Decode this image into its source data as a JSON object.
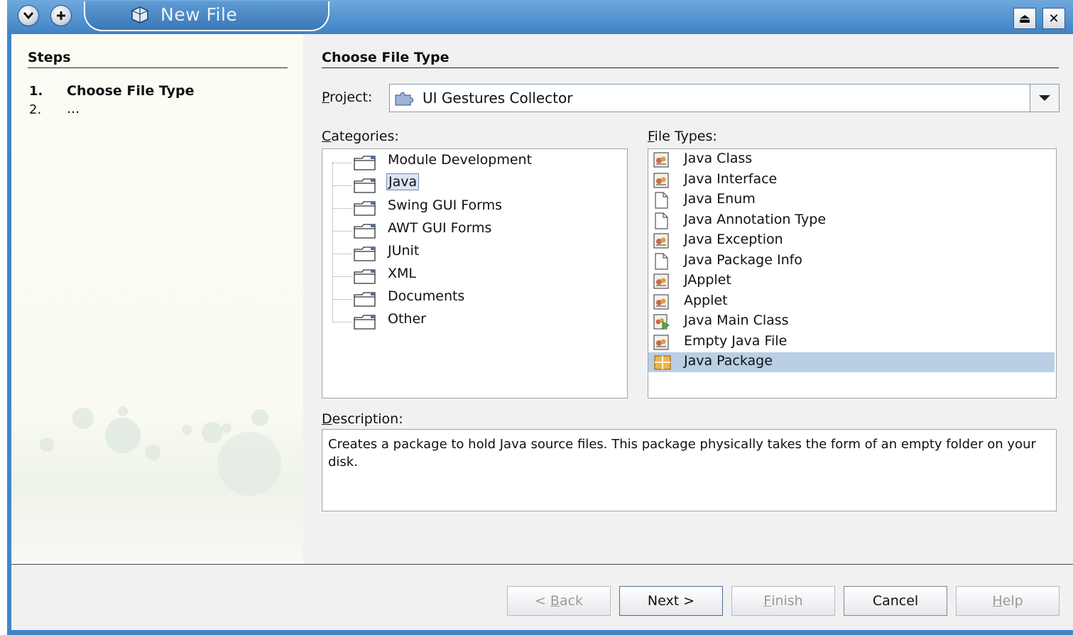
{
  "window": {
    "title": "New File",
    "menu_button": "menu",
    "add_button": "add",
    "maximize_glyph": "⏏",
    "close_glyph": "✕"
  },
  "steps": {
    "heading": "Steps",
    "items": [
      {
        "number": "1.",
        "label": "Choose File Type"
      },
      {
        "number": "2.",
        "label": "..."
      }
    ]
  },
  "main": {
    "heading": "Choose File Type",
    "project_label": "Project:",
    "project_value": "UI Gestures Collector",
    "categories_label": "Categories:",
    "file_types_label": "File Types:",
    "description_label": "Description:",
    "description_text": "Creates a package to hold Java source files. This package physically takes the form of an empty folder on your disk."
  },
  "categories": [
    "Module Development",
    "Java",
    "Swing GUI Forms",
    "AWT GUI Forms",
    "JUnit",
    "XML",
    "Documents",
    "Other"
  ],
  "selected_category": "Java",
  "file_types": [
    {
      "label": "Java Class",
      "icon": "java-class-icon"
    },
    {
      "label": "Java Interface",
      "icon": "java-class-icon"
    },
    {
      "label": "Java Enum",
      "icon": "blank-file-icon"
    },
    {
      "label": "Java Annotation Type",
      "icon": "blank-file-icon"
    },
    {
      "label": "Java Exception",
      "icon": "java-class-icon"
    },
    {
      "label": "Java Package Info",
      "icon": "blank-file-icon"
    },
    {
      "label": "JApplet",
      "icon": "java-class-icon"
    },
    {
      "label": "Applet",
      "icon": "java-class-icon"
    },
    {
      "label": "Java Main Class",
      "icon": "java-main-class-icon"
    },
    {
      "label": "Empty Java File",
      "icon": "java-class-icon"
    },
    {
      "label": "Java Package",
      "icon": "java-package-icon"
    }
  ],
  "selected_file_type": "Java Package",
  "buttons": {
    "back": "< Back",
    "next": "Next >",
    "finish": "Finish",
    "cancel": "Cancel",
    "help": "Help"
  },
  "colors": {
    "title_bar": "#3f82c4",
    "selection": "#b8cfe5",
    "steps_panel": "#fbfbf2"
  }
}
